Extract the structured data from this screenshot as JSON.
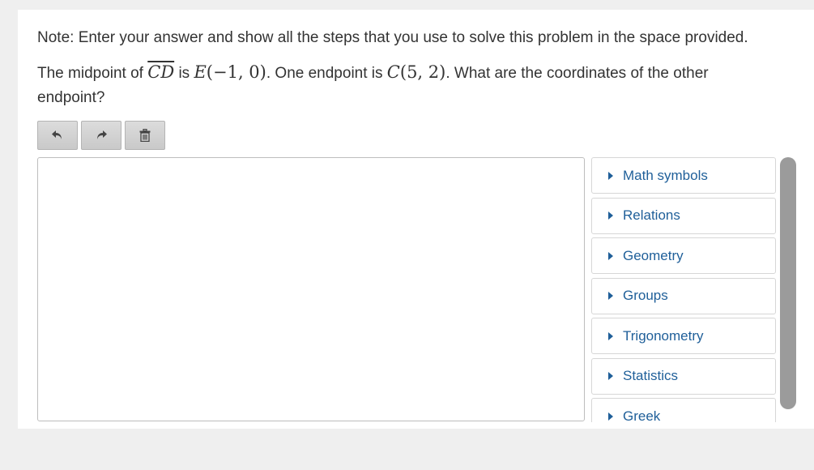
{
  "note": "Note: Enter your answer and show all the steps that you use to solve this problem in the space provided.",
  "question": {
    "prefix": "The midpoint of",
    "segment": "CD",
    "is": "is",
    "midpoint_letter": "E",
    "midpoint_coords": "(−1, 0)",
    "middle": ". One endpoint is",
    "endpoint_letter": "C",
    "endpoint_coords": "(5, 2)",
    "suffix": ". What are the coordinates of the other endpoint?"
  },
  "toolbar": {
    "undo_icon": "undo-icon",
    "redo_icon": "redo-icon",
    "clear_icon": "trash-icon"
  },
  "answer": {
    "value": ""
  },
  "palette": {
    "items": [
      {
        "label": "Math symbols"
      },
      {
        "label": "Relations"
      },
      {
        "label": "Geometry"
      },
      {
        "label": "Groups"
      },
      {
        "label": "Trigonometry"
      },
      {
        "label": "Statistics"
      },
      {
        "label": "Greek"
      }
    ],
    "caret_color": "#1f5f99"
  }
}
